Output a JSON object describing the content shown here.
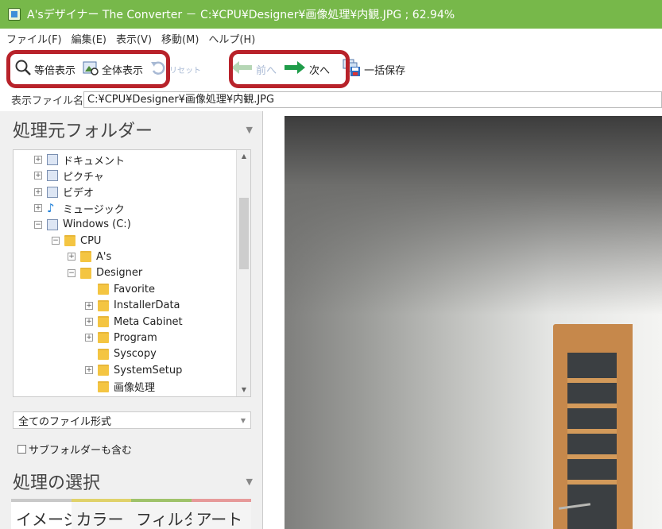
{
  "window": {
    "title": "A'sデザイナー The Converter － C:¥CPU¥Designer¥画像処理¥内観.JPG ; 62.94%"
  },
  "menu": [
    {
      "label": "ファイル(F)"
    },
    {
      "label": "編集(E)"
    },
    {
      "label": "表示(V)"
    },
    {
      "label": "移動(M)"
    },
    {
      "label": "ヘルプ(H)"
    }
  ],
  "toolbar": {
    "actual_size": "等倍表示",
    "fit_all": "全体表示",
    "reset": "リセット",
    "prev": "前へ",
    "next": "次へ",
    "batch_save": "一括保存"
  },
  "path": {
    "label": "表示ファイル名",
    "value": "C:¥CPU¥Designer¥画像処理¥内観.JPG"
  },
  "source_panel": {
    "title": "処理元フォルダー",
    "tree": [
      {
        "label": "ドキュメント",
        "depth": 0,
        "icon": "documents-icon",
        "expander": "+"
      },
      {
        "label": "ピクチャ",
        "depth": 0,
        "icon": "pictures-icon",
        "expander": "+"
      },
      {
        "label": "ビデオ",
        "depth": 0,
        "icon": "videos-icon",
        "expander": "+"
      },
      {
        "label": "ミュージック",
        "depth": 0,
        "icon": "music-icon",
        "expander": "+"
      },
      {
        "label": "Windows (C:)",
        "depth": 0,
        "icon": "drive-icon",
        "expander": "−"
      },
      {
        "label": "CPU",
        "depth": 1,
        "icon": "folder-icon",
        "expander": "−"
      },
      {
        "label": "A's",
        "depth": 2,
        "icon": "folder-icon",
        "expander": "+"
      },
      {
        "label": "Designer",
        "depth": 2,
        "icon": "folder-icon",
        "expander": "−"
      },
      {
        "label": "Favorite",
        "depth": 3,
        "icon": "folder-icon",
        "expander": ""
      },
      {
        "label": "InstallerData",
        "depth": 3,
        "icon": "folder-icon",
        "expander": "+"
      },
      {
        "label": "Meta Cabinet",
        "depth": 3,
        "icon": "folder-icon",
        "expander": "+"
      },
      {
        "label": "Program",
        "depth": 3,
        "icon": "folder-icon",
        "expander": "+"
      },
      {
        "label": "Syscopy",
        "depth": 3,
        "icon": "folder-icon",
        "expander": ""
      },
      {
        "label": "SystemSetup",
        "depth": 3,
        "icon": "folder-icon",
        "expander": "+"
      },
      {
        "label": "画像処理",
        "depth": 3,
        "icon": "folder-icon",
        "expander": ""
      }
    ],
    "filetype_select": "全てのファイル形式",
    "include_subfolders": "サブフォルダーも含む"
  },
  "process_panel": {
    "title": "処理の選択",
    "tabs": [
      {
        "label": "イメージ",
        "color": "#c9c9c9"
      },
      {
        "label": "カラー",
        "color": "#e0d26a"
      },
      {
        "label": "フィルタ...",
        "color": "#9fc26a"
      },
      {
        "label": "アート",
        "color": "#e79a9a"
      }
    ]
  },
  "colors": {
    "titlebar": "#77b84a",
    "highlight": "#b8222a",
    "accent_arrow": "#1f9c4a"
  }
}
